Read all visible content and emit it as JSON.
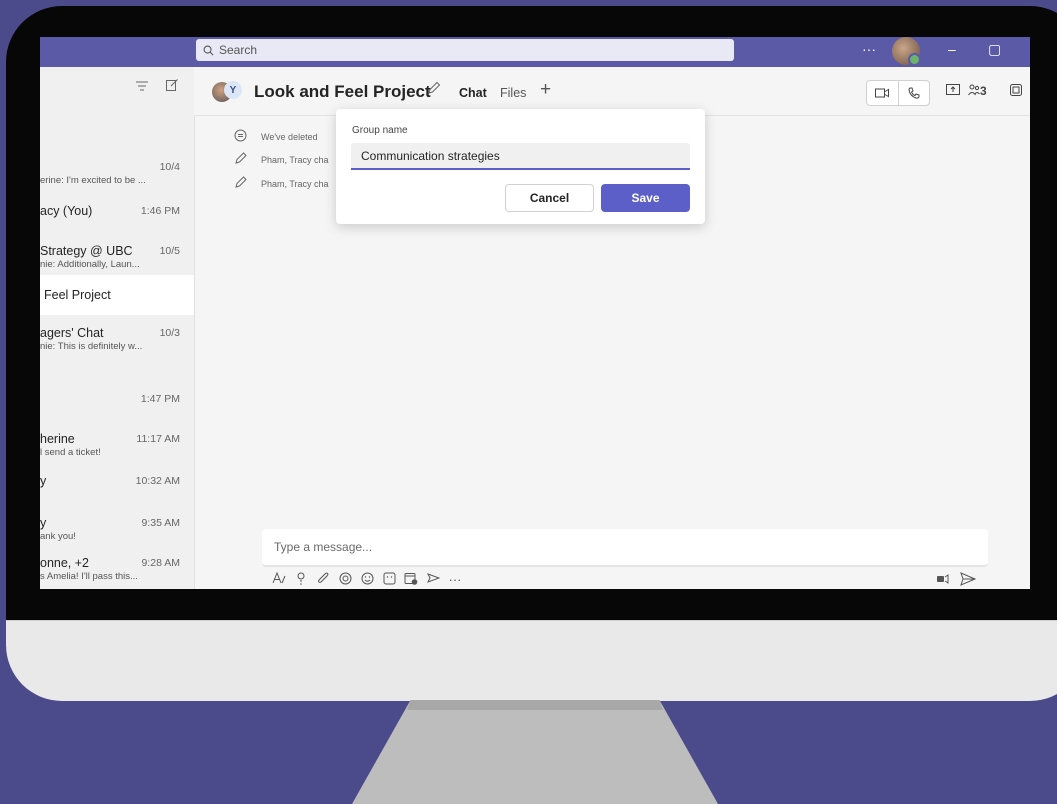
{
  "titlebar": {
    "search_placeholder": "Search",
    "icons": [
      "search-icon",
      "more-icon",
      "avatar",
      "minimize-icon",
      "restore-icon"
    ],
    "more_label": "···",
    "minimize_label": "–",
    "restore_label": "▢"
  },
  "chat_list": {
    "items": [
      {
        "name": "",
        "time": "10/4",
        "preview": "erine: I'm excited to be ..."
      },
      {
        "name": "acy (You)",
        "time": "1:46 PM",
        "preview": ""
      },
      {
        "name": "Strategy @ UBC",
        "time": "10/5",
        "preview": "nie: Additionally, Laun..."
      },
      {
        "name": "Feel Project",
        "time": "",
        "preview": ""
      },
      {
        "name": "agers' Chat",
        "time": "10/3",
        "preview": "nie: This is definitely w..."
      },
      {
        "name": "",
        "time": "1:47 PM",
        "preview": ""
      },
      {
        "name": "herine",
        "time": "11:17 AM",
        "preview": "l send a ticket!"
      },
      {
        "name": "y",
        "time": "10:32 AM",
        "preview": ""
      },
      {
        "name": "y",
        "time": "9:35 AM",
        "preview": "ank you!"
      },
      {
        "name": "onne, +2",
        "time": "9:28 AM",
        "preview": "s Amelia! I'll pass this..."
      }
    ]
  },
  "header": {
    "title": "Look and Feel Project",
    "avatar_initial": "Y",
    "tabs": {
      "chat": "Chat",
      "files": "Files",
      "add": "+"
    },
    "people_count": "3"
  },
  "activity": {
    "lines": [
      "We've deleted",
      "Pham, Tracy cha",
      "Pham, Tracy cha"
    ]
  },
  "dialog": {
    "label": "Group name",
    "value": "Communication strategies",
    "cancel": "Cancel",
    "save": "Save"
  },
  "composer": {
    "placeholder": "Type a message...",
    "more": "···"
  },
  "colors": {
    "accent": "#5b5fc7",
    "titlebar": "#5a5aa6",
    "background": "#4b4a8a"
  }
}
